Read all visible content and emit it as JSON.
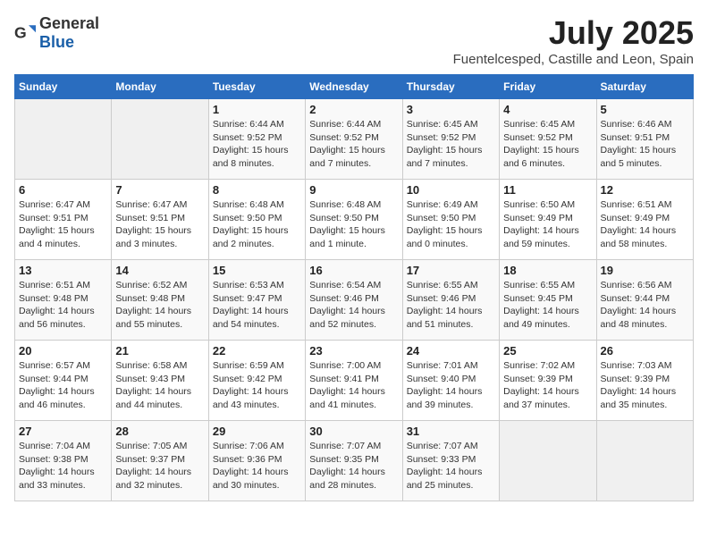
{
  "header": {
    "logo_general": "General",
    "logo_blue": "Blue",
    "month_title": "July 2025",
    "subtitle": "Fuentelcesped, Castille and Leon, Spain"
  },
  "weekdays": [
    "Sunday",
    "Monday",
    "Tuesday",
    "Wednesday",
    "Thursday",
    "Friday",
    "Saturday"
  ],
  "weeks": [
    [
      {
        "day": "",
        "sunrise": "",
        "sunset": "",
        "daylight": ""
      },
      {
        "day": "",
        "sunrise": "",
        "sunset": "",
        "daylight": ""
      },
      {
        "day": "1",
        "sunrise": "Sunrise: 6:44 AM",
        "sunset": "Sunset: 9:52 PM",
        "daylight": "Daylight: 15 hours and 8 minutes."
      },
      {
        "day": "2",
        "sunrise": "Sunrise: 6:44 AM",
        "sunset": "Sunset: 9:52 PM",
        "daylight": "Daylight: 15 hours and 7 minutes."
      },
      {
        "day": "3",
        "sunrise": "Sunrise: 6:45 AM",
        "sunset": "Sunset: 9:52 PM",
        "daylight": "Daylight: 15 hours and 7 minutes."
      },
      {
        "day": "4",
        "sunrise": "Sunrise: 6:45 AM",
        "sunset": "Sunset: 9:52 PM",
        "daylight": "Daylight: 15 hours and 6 minutes."
      },
      {
        "day": "5",
        "sunrise": "Sunrise: 6:46 AM",
        "sunset": "Sunset: 9:51 PM",
        "daylight": "Daylight: 15 hours and 5 minutes."
      }
    ],
    [
      {
        "day": "6",
        "sunrise": "Sunrise: 6:47 AM",
        "sunset": "Sunset: 9:51 PM",
        "daylight": "Daylight: 15 hours and 4 minutes."
      },
      {
        "day": "7",
        "sunrise": "Sunrise: 6:47 AM",
        "sunset": "Sunset: 9:51 PM",
        "daylight": "Daylight: 15 hours and 3 minutes."
      },
      {
        "day": "8",
        "sunrise": "Sunrise: 6:48 AM",
        "sunset": "Sunset: 9:50 PM",
        "daylight": "Daylight: 15 hours and 2 minutes."
      },
      {
        "day": "9",
        "sunrise": "Sunrise: 6:48 AM",
        "sunset": "Sunset: 9:50 PM",
        "daylight": "Daylight: 15 hours and 1 minute."
      },
      {
        "day": "10",
        "sunrise": "Sunrise: 6:49 AM",
        "sunset": "Sunset: 9:50 PM",
        "daylight": "Daylight: 15 hours and 0 minutes."
      },
      {
        "day": "11",
        "sunrise": "Sunrise: 6:50 AM",
        "sunset": "Sunset: 9:49 PM",
        "daylight": "Daylight: 14 hours and 59 minutes."
      },
      {
        "day": "12",
        "sunrise": "Sunrise: 6:51 AM",
        "sunset": "Sunset: 9:49 PM",
        "daylight": "Daylight: 14 hours and 58 minutes."
      }
    ],
    [
      {
        "day": "13",
        "sunrise": "Sunrise: 6:51 AM",
        "sunset": "Sunset: 9:48 PM",
        "daylight": "Daylight: 14 hours and 56 minutes."
      },
      {
        "day": "14",
        "sunrise": "Sunrise: 6:52 AM",
        "sunset": "Sunset: 9:48 PM",
        "daylight": "Daylight: 14 hours and 55 minutes."
      },
      {
        "day": "15",
        "sunrise": "Sunrise: 6:53 AM",
        "sunset": "Sunset: 9:47 PM",
        "daylight": "Daylight: 14 hours and 54 minutes."
      },
      {
        "day": "16",
        "sunrise": "Sunrise: 6:54 AM",
        "sunset": "Sunset: 9:46 PM",
        "daylight": "Daylight: 14 hours and 52 minutes."
      },
      {
        "day": "17",
        "sunrise": "Sunrise: 6:55 AM",
        "sunset": "Sunset: 9:46 PM",
        "daylight": "Daylight: 14 hours and 51 minutes."
      },
      {
        "day": "18",
        "sunrise": "Sunrise: 6:55 AM",
        "sunset": "Sunset: 9:45 PM",
        "daylight": "Daylight: 14 hours and 49 minutes."
      },
      {
        "day": "19",
        "sunrise": "Sunrise: 6:56 AM",
        "sunset": "Sunset: 9:44 PM",
        "daylight": "Daylight: 14 hours and 48 minutes."
      }
    ],
    [
      {
        "day": "20",
        "sunrise": "Sunrise: 6:57 AM",
        "sunset": "Sunset: 9:44 PM",
        "daylight": "Daylight: 14 hours and 46 minutes."
      },
      {
        "day": "21",
        "sunrise": "Sunrise: 6:58 AM",
        "sunset": "Sunset: 9:43 PM",
        "daylight": "Daylight: 14 hours and 44 minutes."
      },
      {
        "day": "22",
        "sunrise": "Sunrise: 6:59 AM",
        "sunset": "Sunset: 9:42 PM",
        "daylight": "Daylight: 14 hours and 43 minutes."
      },
      {
        "day": "23",
        "sunrise": "Sunrise: 7:00 AM",
        "sunset": "Sunset: 9:41 PM",
        "daylight": "Daylight: 14 hours and 41 minutes."
      },
      {
        "day": "24",
        "sunrise": "Sunrise: 7:01 AM",
        "sunset": "Sunset: 9:40 PM",
        "daylight": "Daylight: 14 hours and 39 minutes."
      },
      {
        "day": "25",
        "sunrise": "Sunrise: 7:02 AM",
        "sunset": "Sunset: 9:39 PM",
        "daylight": "Daylight: 14 hours and 37 minutes."
      },
      {
        "day": "26",
        "sunrise": "Sunrise: 7:03 AM",
        "sunset": "Sunset: 9:39 PM",
        "daylight": "Daylight: 14 hours and 35 minutes."
      }
    ],
    [
      {
        "day": "27",
        "sunrise": "Sunrise: 7:04 AM",
        "sunset": "Sunset: 9:38 PM",
        "daylight": "Daylight: 14 hours and 33 minutes."
      },
      {
        "day": "28",
        "sunrise": "Sunrise: 7:05 AM",
        "sunset": "Sunset: 9:37 PM",
        "daylight": "Daylight: 14 hours and 32 minutes."
      },
      {
        "day": "29",
        "sunrise": "Sunrise: 7:06 AM",
        "sunset": "Sunset: 9:36 PM",
        "daylight": "Daylight: 14 hours and 30 minutes."
      },
      {
        "day": "30",
        "sunrise": "Sunrise: 7:07 AM",
        "sunset": "Sunset: 9:35 PM",
        "daylight": "Daylight: 14 hours and 28 minutes."
      },
      {
        "day": "31",
        "sunrise": "Sunrise: 7:07 AM",
        "sunset": "Sunset: 9:33 PM",
        "daylight": "Daylight: 14 hours and 25 minutes."
      },
      {
        "day": "",
        "sunrise": "",
        "sunset": "",
        "daylight": ""
      },
      {
        "day": "",
        "sunrise": "",
        "sunset": "",
        "daylight": ""
      }
    ]
  ]
}
